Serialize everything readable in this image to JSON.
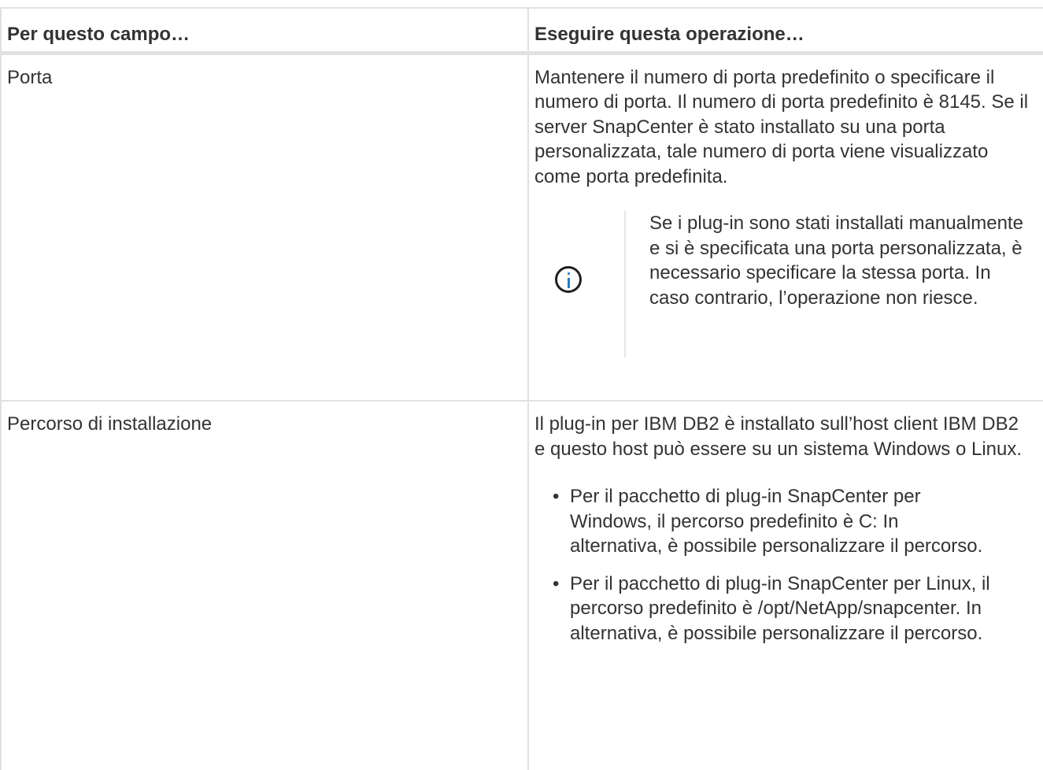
{
  "table": {
    "headers": {
      "field": "Per questo campo…",
      "action": "Eseguire questa operazione…"
    },
    "rows": [
      {
        "field": "Porta",
        "description": "Mantenere il numero di porta predefinito o specificare il numero di porta. Il numero di porta predefinito è 8145. Se il server SnapCenter è stato installato su una porta personalizzata, tale numero di porta viene visualizzato come porta predefinita.",
        "note": {
          "icon": "info-icon",
          "text": "Se i plug-in sono stati installati manualmente e si è specificata una porta personalizzata, è necessario specificare la stessa porta. In caso contrario, l’operazione non riesce."
        }
      },
      {
        "field": "Percorso di installazione",
        "description": "Il plug-in per IBM DB2 è installato sull’host client IBM DB2 e questo host può essere su un sistema Windows o Linux.",
        "bullets": [
          "Per il pacchetto di plug-in SnapCenter per Windows, il percorso predefinito è C: In alternativa, è possibile personalizzare il percorso.",
          "Per il pacchetto di plug-in SnapCenter per Linux, il percorso predefinito è /opt/NetApp/snapcenter. In alternativa, è possibile personalizzare il percorso."
        ]
      }
    ]
  },
  "colors": {
    "text": "#333333",
    "border": "#e1e1e1",
    "info_accent": "#1b7fd1"
  }
}
